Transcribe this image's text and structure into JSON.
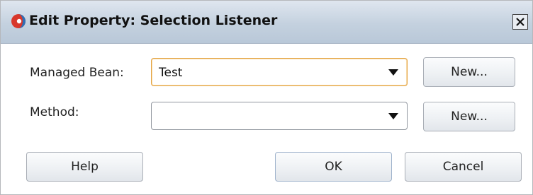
{
  "dialog": {
    "title": "Edit Property: Selection Listener",
    "close_glyph": "✕",
    "title_icon": "oracle-swirl-icon",
    "close_icon": "close-icon"
  },
  "form": {
    "managed_bean": {
      "label": "Managed Bean:",
      "value": "Test",
      "new_button": "New..."
    },
    "method": {
      "label": "Method:",
      "value": "",
      "new_button": "New..."
    }
  },
  "footer": {
    "help_button": "Help",
    "ok_button": "OK",
    "cancel_button": "Cancel"
  },
  "colors": {
    "title_gradient_top": "#dfe6ef",
    "title_gradient_bottom": "#b9c8d8",
    "focus_border": "#e4a341",
    "icon_red": "#d8372b",
    "icon_blue": "#2f6fb5"
  }
}
